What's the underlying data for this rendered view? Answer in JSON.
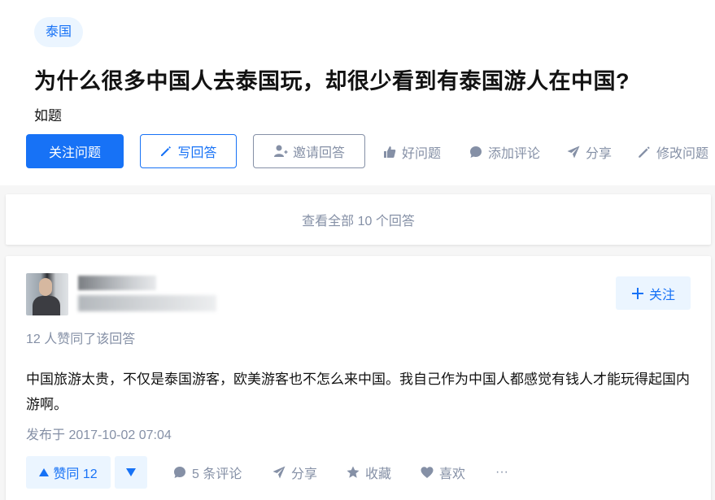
{
  "question": {
    "topic": "泰国",
    "title": "为什么很多中国人去泰国玩，却很少看到有泰国游人在中国?",
    "detail": "如题",
    "buttons": {
      "follow": "关注问题",
      "write": "写回答",
      "invite": "邀请回答"
    },
    "actions": {
      "good": "好问题",
      "comment": "添加评论",
      "share": "分享",
      "edit": "修改问题"
    }
  },
  "view_all": "查看全部 10 个回答",
  "answer": {
    "follow_label": "关注",
    "vote_summary": "12 人赞同了该回答",
    "content": "中国旅游太贵，不仅是泰国游客，欧美游客也不怎么来中国。我自己作为中国人都感觉有钱人才能玩得起国内游啊。",
    "published": "发布于 2017-10-02 07:04",
    "upvote_label": "赞同 12",
    "actions": {
      "comments": "5 条评论",
      "share": "分享",
      "collect": "收藏",
      "like": "喜欢",
      "more": "···"
    }
  },
  "colors": {
    "accent": "#1772f6",
    "accent_bg": "#ebf5ff",
    "muted": "#8590a6",
    "text": "#121212",
    "page_bg": "#f6f6f6"
  }
}
